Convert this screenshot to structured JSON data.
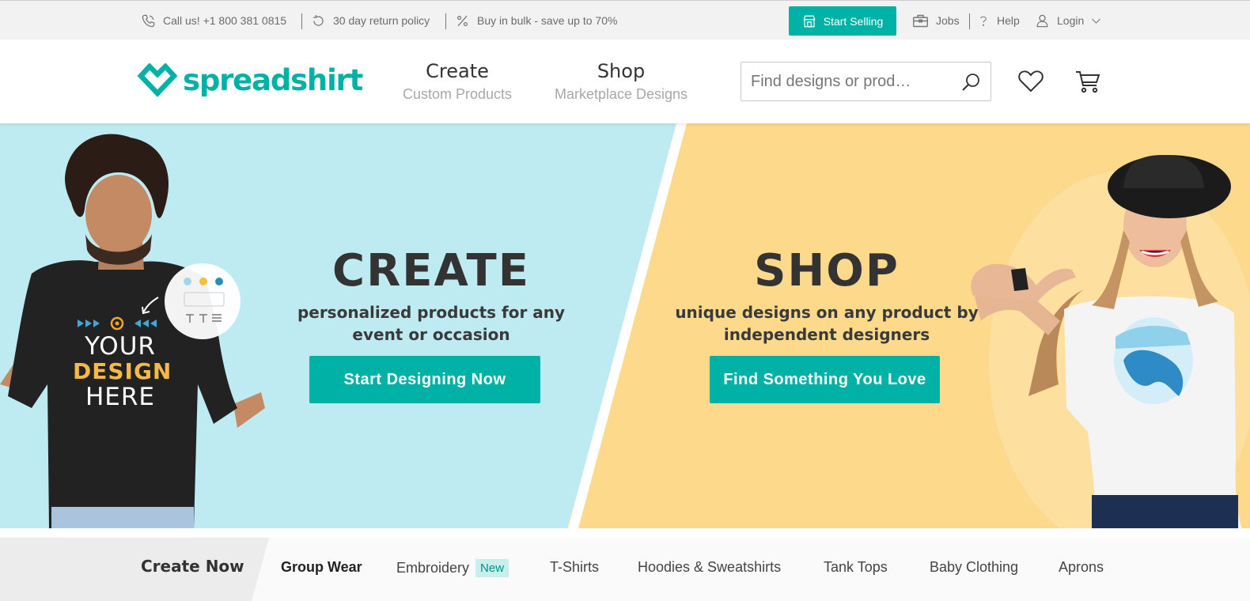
{
  "topbar": {
    "phone": "Call us! +1 800 381 0815",
    "returns": "30 day return policy",
    "bulk": "Buy in bulk - save up to 70%",
    "start_selling": "Start Selling",
    "jobs": "Jobs",
    "help": "Help",
    "login": "Login"
  },
  "header": {
    "logo": "spreadshirt",
    "nav": [
      {
        "title": "Create",
        "subtitle": "Custom Products"
      },
      {
        "title": "Shop",
        "subtitle": "Marketplace Designs"
      }
    ],
    "search_placeholder": "Find designs or prod…"
  },
  "hero": {
    "create": {
      "title": "CREATE",
      "subtitle_line1": "personalized products for any",
      "subtitle_line2": "event or occasion",
      "button": "Start Designing Now"
    },
    "shop": {
      "title": "SHOP",
      "subtitle_line1": "unique designs on any product by",
      "subtitle_line2": "independent designers",
      "button": "Find Something You Love"
    },
    "shirt_text": [
      "YOUR",
      "DESIGN",
      "HERE"
    ]
  },
  "categories": {
    "create_now": "Create Now",
    "items": [
      {
        "label": "Group Wear"
      },
      {
        "label": "Embroidery",
        "badge": "New"
      },
      {
        "label": "T-Shirts"
      },
      {
        "label": "Hoodies & Sweatshirts"
      },
      {
        "label": "Tank Tops"
      },
      {
        "label": "Baby Clothing"
      },
      {
        "label": "Aprons"
      }
    ]
  },
  "colors": {
    "accent": "#00b2a5",
    "create_bg": "#bdebf1",
    "shop_bg": "#fdd98c",
    "text_dark": "#333333"
  },
  "icons": [
    "phone-icon",
    "return-icon",
    "percent-icon",
    "store-icon",
    "briefcase-icon",
    "help-icon",
    "user-icon",
    "chevron-down-icon",
    "search-icon",
    "heart-icon",
    "cart-icon"
  ]
}
